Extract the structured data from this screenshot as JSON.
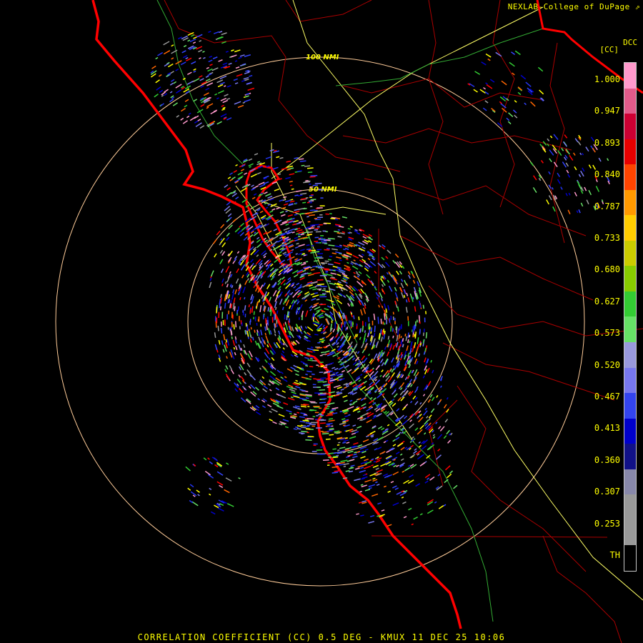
{
  "header": {
    "credit": "NEXLAB-College of DuPage",
    "product_code": "DCC",
    "product_unit": "[CC]"
  },
  "range_rings": [
    {
      "label": "100 NMI"
    },
    {
      "label": "50 NMI"
    }
  ],
  "legend": {
    "labels": [
      "1.000",
      "0.947",
      "0.893",
      "0.840",
      "0.787",
      "0.733",
      "0.680",
      "0.627",
      "0.573",
      "0.520",
      "0.467",
      "0.413",
      "0.360",
      "0.307",
      "0.253",
      "TH"
    ],
    "colors": [
      "#ff99cc",
      "#e05a8a",
      "#cc0033",
      "#e80000",
      "#ff4400",
      "#ff9900",
      "#ffcc00",
      "#cccc00",
      "#88cc00",
      "#33cc33",
      "#66e066",
      "#9999dd",
      "#7777ee",
      "#3344ee",
      "#0000cc",
      "#111188",
      "#8888aa",
      "#999999",
      "#999999",
      "#000000"
    ]
  },
  "footer": {
    "text": "CORRELATION COEFFICIENT (CC) 0.5 DEG - KMUX 11 DEC 25 10:06"
  },
  "colors": {
    "text": "#ffff00",
    "coastline": "#ff0000",
    "boundaries": "#aa0000",
    "highways": "#ffff66",
    "ring": "#ffcc99"
  }
}
